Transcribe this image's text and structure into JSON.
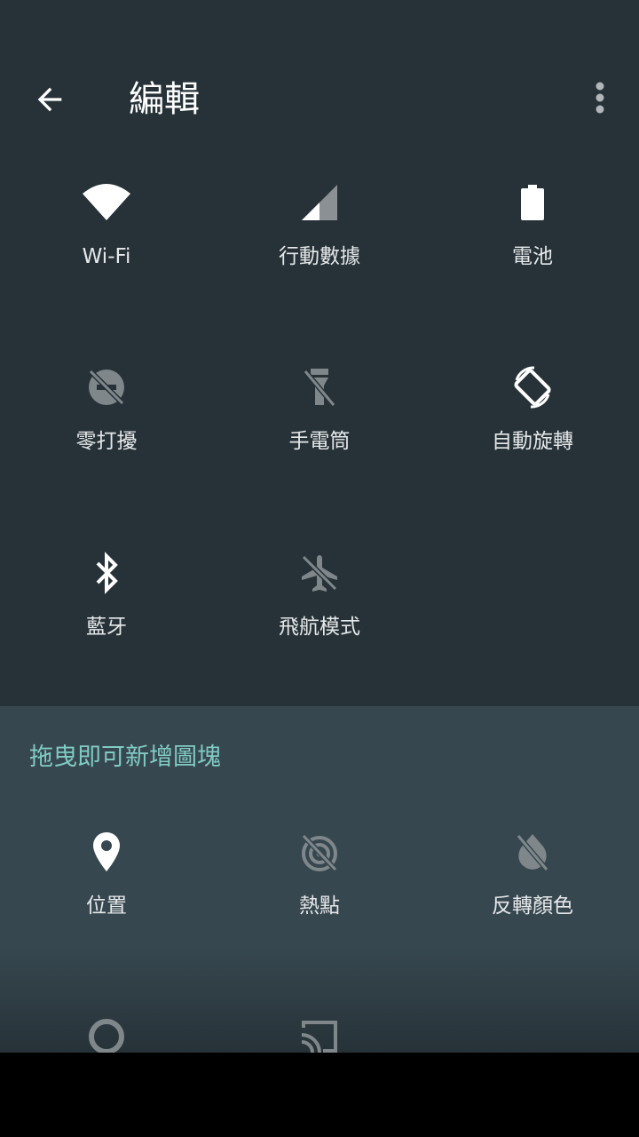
{
  "app_bar": {
    "title": "編輯",
    "back_icon": "arrow-back-icon",
    "more_icon": "more-vert-icon"
  },
  "active_tiles": [
    {
      "label": "Wi-Fi",
      "icon": "wifi-icon"
    },
    {
      "label": "行動數據",
      "icon": "cellular-signal-icon"
    },
    {
      "label": "電池",
      "icon": "battery-icon"
    },
    {
      "label": "零打擾",
      "icon": "do-not-disturb-off-icon"
    },
    {
      "label": "手電筒",
      "icon": "flashlight-off-icon"
    },
    {
      "label": "自動旋轉",
      "icon": "screen-rotation-icon"
    },
    {
      "label": "藍牙",
      "icon": "bluetooth-icon"
    },
    {
      "label": "飛航模式",
      "icon": "airplane-off-icon"
    }
  ],
  "available": {
    "hint": "拖曳即可新增圖塊",
    "tiles": [
      {
        "label": "位置",
        "icon": "location-pin-icon"
      },
      {
        "label": "熱點",
        "icon": "hotspot-off-icon"
      },
      {
        "label": "反轉顏色",
        "icon": "invert-colors-off-icon"
      },
      {
        "label": "",
        "icon": "data-saver-icon"
      },
      {
        "label": "",
        "icon": "cast-icon"
      }
    ]
  },
  "colors": {
    "background_top": "#263238",
    "background_bottom": "#37474f",
    "accent": "#80cbc4"
  }
}
